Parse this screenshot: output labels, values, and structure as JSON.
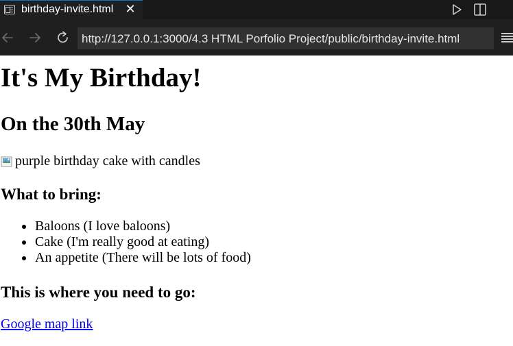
{
  "tab": {
    "title": "birthday-invite.html",
    "icons": {
      "preview": "preview-icon",
      "close": "close-icon",
      "run": "play-icon",
      "split": "split-editor-icon"
    }
  },
  "address_bar": {
    "url": "http://127.0.0.1:3000/4.3 HTML Porfolio Project/public/birthday-invite.html",
    "icons": {
      "back": "arrow-left-icon",
      "forward": "arrow-right-icon",
      "reload": "reload-icon",
      "menu": "menu-icon"
    }
  },
  "page": {
    "heading": "It's My Birthday!",
    "date": "On the 30th May",
    "image_alt": "purple birthday cake with candles",
    "bring_heading": "What to bring:",
    "bring_items": [
      "Baloons (I love baloons)",
      "Cake (I'm really good at eating)",
      "An appetite (There will be lots of food)"
    ],
    "location_heading": "This is where you need to go:",
    "map_link": "Google map link"
  },
  "colors": {
    "tab_bar": "#181818",
    "address_bar": "#1f1f1f",
    "url_box": "#313131",
    "link": "#0000ee"
  }
}
